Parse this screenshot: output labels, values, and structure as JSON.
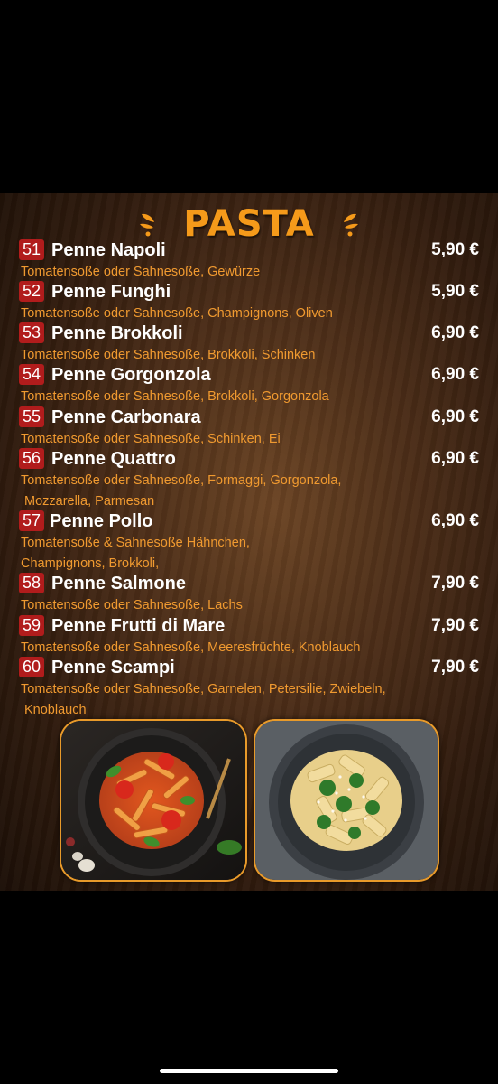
{
  "menu": {
    "title": "PASTA",
    "items": [
      {
        "number": "51",
        "name": "Penne Napoli",
        "price": "5,90 €",
        "description": [
          "Tomatensoße oder Sahnesoße, Gewürze"
        ]
      },
      {
        "number": "52",
        "name": "Penne Funghi",
        "price": "5,90 €",
        "description": [
          "Tomatensoße oder Sahnesoße, Champignons, Oliven"
        ]
      },
      {
        "number": "53",
        "name": "Penne Brokkoli",
        "price": "6,90 €",
        "description": [
          "Tomatensoße oder Sahnesoße, Brokkoli, Schinken"
        ]
      },
      {
        "number": "54",
        "name": "Penne Gorgonzola",
        "price": "6,90 €",
        "description": [
          "Tomatensoße oder Sahnesoße, Brokkoli, Gorgonzola"
        ]
      },
      {
        "number": "55",
        "name": "Penne Carbonara",
        "price": "6,90 €",
        "description": [
          "Tomatensoße oder Sahnesoße, Schinken, Ei"
        ]
      },
      {
        "number": "56",
        "name": "Penne Quattro",
        "price": "6,90 €",
        "description": [
          "Tomatensoße oder Sahnesoße, Formaggi, Gorgonzola,",
          "Mozzarella, Parmesan"
        ]
      },
      {
        "number": "57",
        "name": "Penne Pollo",
        "price": "6,90 €",
        "description": [
          "Tomatensoße & Sahnesoße Hähnchen,",
          "Champignons, Brokkoli,"
        ]
      },
      {
        "number": "58",
        "name": "Penne Salmone",
        "price": "7,90 €",
        "description": [
          "Tomatensoße oder Sahnesoße, Lachs"
        ]
      },
      {
        "number": "59",
        "name": "Penne Frutti di Mare",
        "price": "7,90 €",
        "description": [
          "Tomatensoße oder Sahnesoße, Meeresfrüchte, Knoblauch"
        ]
      },
      {
        "number": "60",
        "name": "Penne Scampi",
        "price": "7,90 €",
        "description": [
          "Tomatensoße oder Sahnesoße, Garnelen, Petersilie, Zwiebeln,",
          "Knoblauch"
        ]
      }
    ],
    "colors": {
      "title": "#f59a1a",
      "number_badge": "#b11c1c",
      "description": "#f09a30",
      "photo_border": "#e89a2a"
    },
    "photos": [
      {
        "icon": "penne-tomato-photo"
      },
      {
        "icon": "penne-broccoli-cream-photo"
      }
    ]
  }
}
